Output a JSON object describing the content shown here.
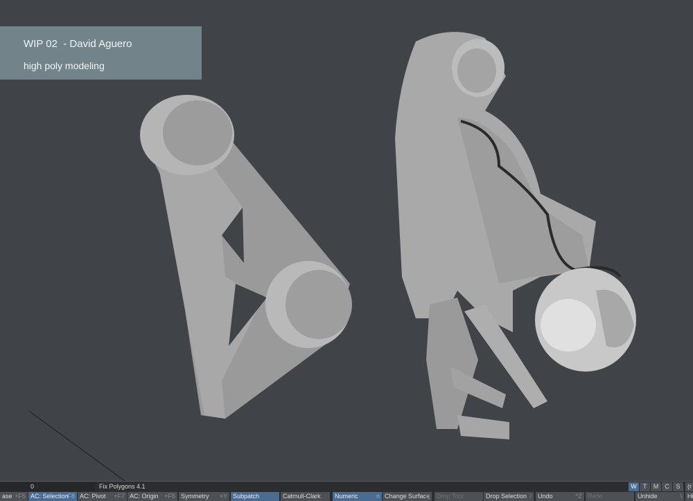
{
  "overlay": {
    "title": "WIP 02  - David Aguero",
    "subtitle": "high poly modeling"
  },
  "status_bar": {
    "field_value": "0",
    "field_empty": "",
    "tool_name": "Fix Polygons 4.1",
    "view_toggles": [
      {
        "label": "W",
        "active": true
      },
      {
        "label": "T",
        "active": false
      },
      {
        "label": "M",
        "active": false
      },
      {
        "label": "C",
        "active": false
      },
      {
        "label": "S",
        "active": false
      }
    ],
    "trailing": "(r"
  },
  "toolbar": [
    {
      "label": "ase",
      "key": "+F5",
      "state": "normal"
    },
    {
      "label": "AC: Selection",
      "key": "+F8",
      "state": "active"
    },
    {
      "label": "AC: Pivot",
      "key": "+F7",
      "state": "normal"
    },
    {
      "label": "AC: Origin",
      "key": "+F6",
      "state": "normal"
    },
    {
      "label": "Symmetry",
      "key": "+Y",
      "state": "normal"
    },
    {
      "label": "Subpatch",
      "key": "",
      "state": "active"
    },
    {
      "label": "Catmull-Clark",
      "key": "",
      "state": "normal"
    },
    {
      "label": "Numeric",
      "key": "n",
      "state": "active"
    },
    {
      "label": "Change Surface",
      "key": "q",
      "state": "normal"
    },
    {
      "label": "Drop Tool",
      "key": "",
      "state": "disabled"
    },
    {
      "label": "Drop Selection",
      "key": "/",
      "state": "normal"
    },
    {
      "label": "Undo",
      "key": "^Z",
      "state": "normal"
    },
    {
      "label": "Redo",
      "key": "",
      "state": "disabled"
    },
    {
      "label": "Unhide",
      "key": "\\",
      "state": "normal"
    },
    {
      "label": "Hi",
      "key": "",
      "state": "normal"
    }
  ],
  "colors": {
    "viewport": "#404347",
    "overlay": "#728489",
    "active": "#4a6c91"
  }
}
